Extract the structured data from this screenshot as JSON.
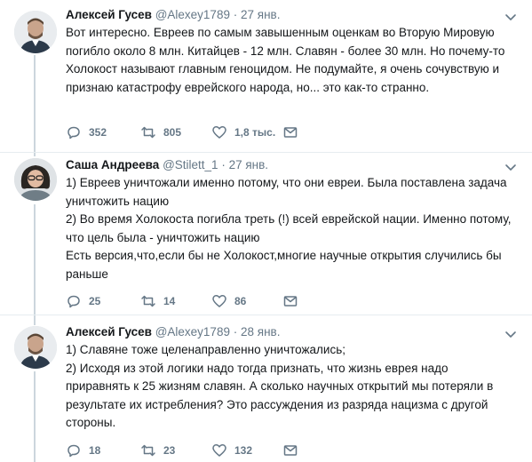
{
  "tweets": [
    {
      "name": "Алексей Гусев",
      "handle": "@Alexey1789",
      "dot": "·",
      "time": "27 янв.",
      "text": "Вот интересно. Евреев по самым завышенным оценкам во Вторую Мировую погибло около 8 млн. Китайцев - 12 млн. Славян - более 30 млн. Но почему-то Холокост называют главным геноцидом. Не подумайте, я очень сочувствую и признаю катастрофу еврейского народа, но... это как-то странно.",
      "replies": "352",
      "retweets": "805",
      "likes": "1,8 тыс."
    },
    {
      "name": "Саша Андреева",
      "handle": "@Stilett_1",
      "dot": "·",
      "time": "27 янв.",
      "text": "1) Евреев уничтожали именно потому, что они евреи. Была поставлена задача уничтожить нацию\n2) Во время Холокоста погибла треть (!) всей еврейской нации. Именно потому, что цель была - уничтожить нацию\nЕсть версия,что,если бы не Холокост,многие научные открытия случились бы раньше",
      "replies": "25",
      "retweets": "14",
      "likes": "86"
    },
    {
      "name": "Алексей Гусев",
      "handle": "@Alexey1789",
      "dot": "·",
      "time": "28 янв.",
      "text": "1) Славяне тоже целенаправленно уничтожались;\n2) Исходя из этой логики надо тогда признать, что жизнь еврея надо приравнять к 25 жизням славян. А сколько научных открытий мы потеряли в результате их истребления? Это рассуждения из разряда нацизма с другой стороны.",
      "replies": "18",
      "retweets": "23",
      "likes": "132"
    }
  ],
  "icons": {
    "reply": "reply-icon",
    "retweet": "retweet-icon",
    "like": "heart-icon",
    "message": "envelope-icon",
    "more": "chevron-down-icon"
  },
  "colors": {
    "icon_gray": "#657786",
    "text": "#14171a",
    "separator": "#e6ecf0",
    "thread_line": "#ccd6dd"
  }
}
